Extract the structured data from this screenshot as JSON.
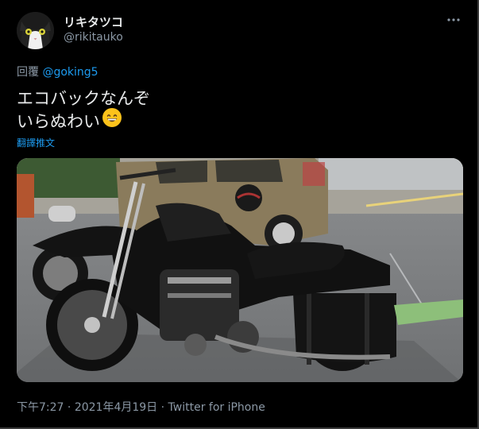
{
  "author": {
    "display_name": "リキタツコ",
    "handle": "@rikitauko"
  },
  "reply": {
    "prefix": "回覆",
    "mention": "@goking5"
  },
  "tweet": {
    "line1": "エコバックなんぞ",
    "line2": "いらぬわい",
    "emoji_icon": "grinning-face-emoji"
  },
  "translate_label": "翻譯推文",
  "meta": {
    "time": "下午7:27",
    "dot1": " · ",
    "date": "2021年4月19日",
    "dot2": " · ",
    "source": "Twitter for iPhone"
  },
  "colors": {
    "background": "#000000",
    "link": "#1d9bf0",
    "secondary_text": "#8b98a5",
    "primary_text": "#e7e9ea"
  }
}
